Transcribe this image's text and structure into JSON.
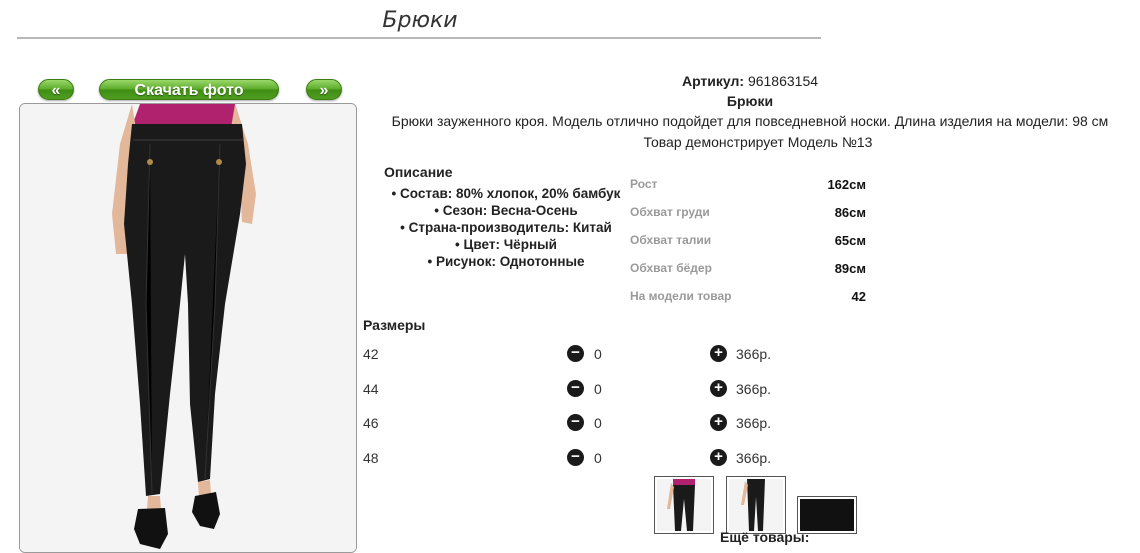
{
  "header": {
    "title": "Брюки"
  },
  "gallery": {
    "prev_label": "«",
    "download_label": "Скачать фото",
    "next_label": "»"
  },
  "product": {
    "article_label": "Артикул:",
    "article_value": "961863154",
    "name": "Брюки",
    "description": "Брюки зауженного кроя. Модель отлично подойдет для повседневной носки. Длина изделия на модели: 98 см",
    "model_note": "Товар демонстрирует Модель №13"
  },
  "details": {
    "heading": "Описание",
    "items": [
      "Состав: 80% хлопок, 20% бамбук",
      "Сезон: Весна-Осень",
      "Страна-производитель: Китай",
      "Цвет: Чёрный",
      "Рисунок: Однотонные"
    ]
  },
  "measurements": [
    {
      "label": "Рост",
      "value": "162см"
    },
    {
      "label": "Обхват груди",
      "value": "86см"
    },
    {
      "label": "Обхват талии",
      "value": "65см"
    },
    {
      "label": "Обхват бёдер",
      "value": "89см"
    },
    {
      "label": "На модели товар",
      "value": "42"
    }
  ],
  "sizes": {
    "heading": "Размеры",
    "minus_symbol": "−",
    "plus_symbol": "+",
    "rows": [
      {
        "size": "42",
        "qty": "0",
        "price": "366р."
      },
      {
        "size": "44",
        "qty": "0",
        "price": "366р."
      },
      {
        "size": "46",
        "qty": "0",
        "price": "366р."
      },
      {
        "size": "48",
        "qty": "0",
        "price": "366р."
      }
    ]
  },
  "more": {
    "heading": "Ещё товары:"
  },
  "icons": {
    "minus": "minus-circle-icon",
    "plus": "plus-circle-icon"
  },
  "colors": {
    "button_green": "#4f9e20",
    "product_black": "#1a1a1a",
    "top_magenta": "#b0226e"
  }
}
